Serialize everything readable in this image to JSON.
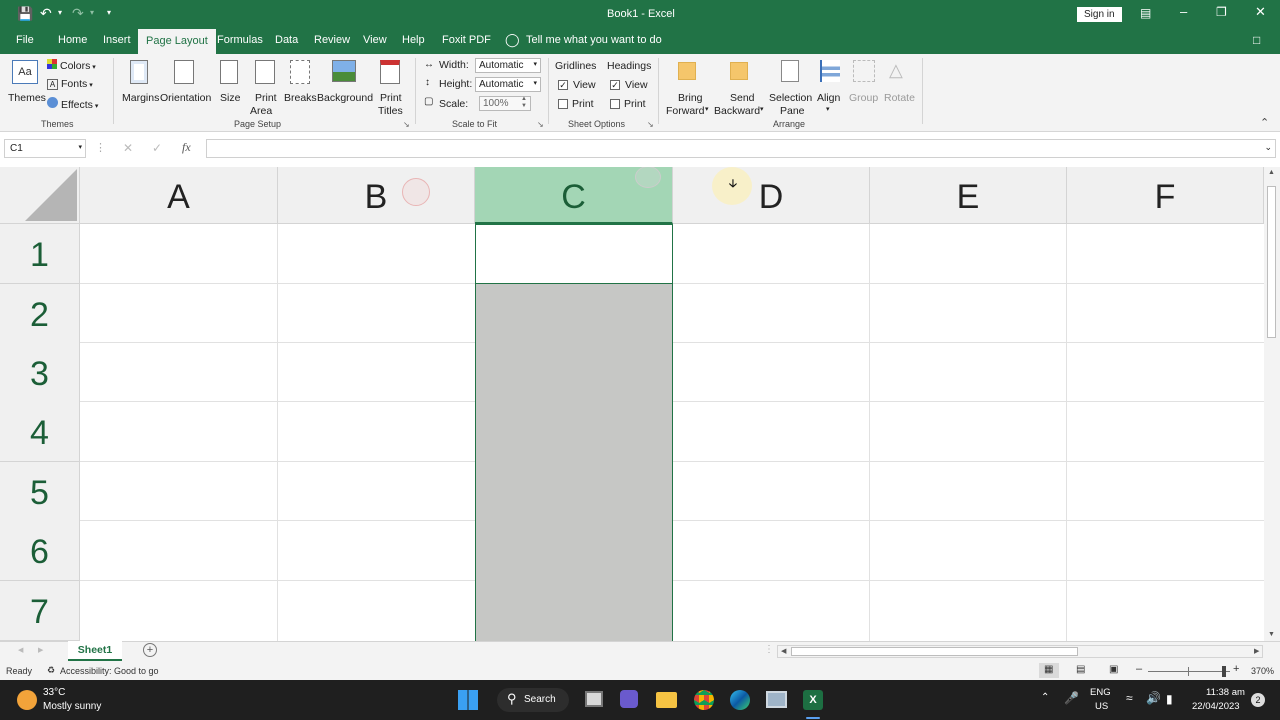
{
  "title_bar": {
    "title": "Book1  -  Excel",
    "sign_in": "Sign in"
  },
  "tabs": [
    "File",
    "Home",
    "Insert",
    "Page Layout",
    "Formulas",
    "Data",
    "Review",
    "View",
    "Help",
    "Foxit PDF"
  ],
  "tell_me": "Tell me what you want to do",
  "ribbon": {
    "themes": {
      "themes": "Themes",
      "colors": "Colors",
      "fonts": "Fonts",
      "effects": "Effects",
      "group": "Themes"
    },
    "page_setup": {
      "margins": "Margins",
      "orientation": "Orientation",
      "size": "Size",
      "print": "Print",
      "area": "Area",
      "breaks": "Breaks",
      "background": "Background",
      "print2": "Print",
      "titles": "Titles",
      "group": "Page Setup"
    },
    "scale": {
      "width_label": "Width:",
      "width_value": "Automatic",
      "height_label": "Height:",
      "height_value": "Automatic",
      "scale_label": "Scale:",
      "scale_value": "100%",
      "group": "Scale to Fit"
    },
    "sheet_options": {
      "gridlines": "Gridlines",
      "headings": "Headings",
      "view": "View",
      "print": "Print",
      "group": "Sheet Options"
    },
    "arrange": {
      "bring": "Bring",
      "forward": "Forward",
      "send": "Send",
      "backward": "Backward",
      "selection": "Selection",
      "pane": "Pane",
      "align": "Align",
      "group_btn": "Group",
      "rotate": "Rotate",
      "group": "Arrange"
    }
  },
  "name_box": "C1",
  "formula_value": "",
  "columns": [
    "A",
    "B",
    "C",
    "D",
    "E",
    "F"
  ],
  "rows": [
    "1",
    "2",
    "3",
    "4",
    "5",
    "6",
    "7"
  ],
  "selected_column": "C",
  "sheet_tab": "Sheet1",
  "status": {
    "ready": "Ready",
    "accessibility": "Accessibility: Good to go",
    "zoom": "370%"
  },
  "taskbar": {
    "temp": "33°C",
    "weather": "Mostly sunny",
    "search": "Search",
    "lang1": "ENG",
    "lang2": "US",
    "time": "11:38 am",
    "date": "22/04/2023",
    "notif": "2"
  },
  "colors": {
    "accent": "#217346",
    "selected_header": "#a3d6b5",
    "selected_column": "#c6c7c5"
  }
}
